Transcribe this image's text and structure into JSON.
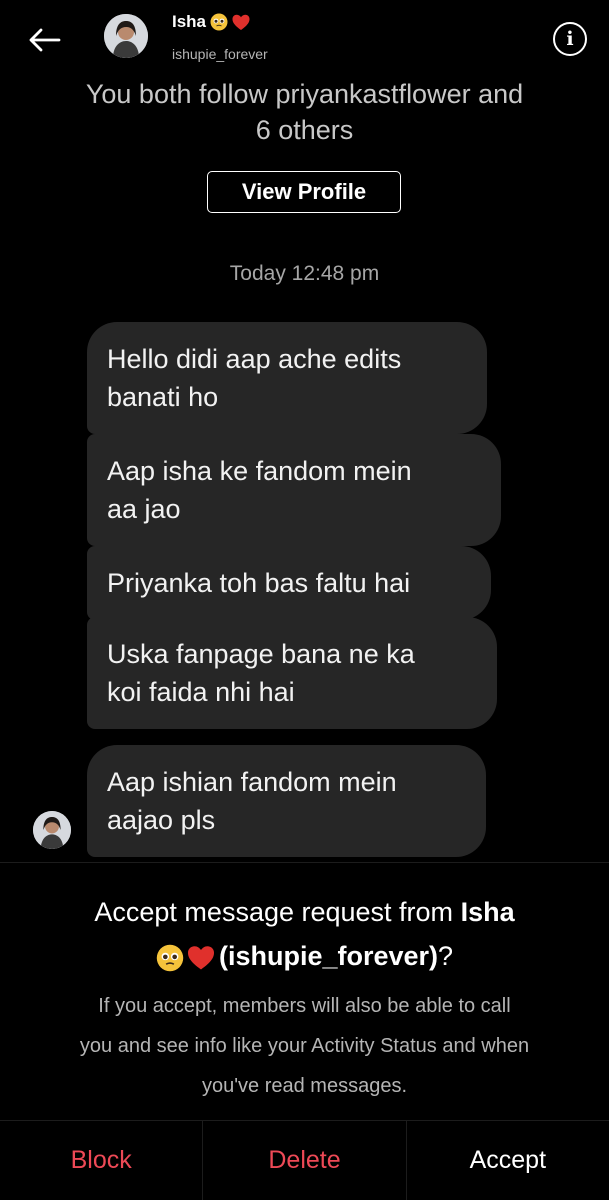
{
  "header": {
    "name": "Isha",
    "username": "ishupie_forever",
    "name_emojis": [
      "pleading-face-emoji",
      "red-heart-emoji"
    ]
  },
  "profile_card": {
    "mutual_line1": "You both follow priyankastflower and",
    "mutual_line2": "6 others",
    "view_profile_label": "View Profile"
  },
  "conversation": {
    "timestamp": "Today 12:48 pm",
    "messages": [
      {
        "line1": "Hello didi aap ache edits",
        "line2": "banati ho"
      },
      {
        "line1": "Aap isha ke fandom mein",
        "line2": "aa jao"
      },
      {
        "line1": "Priyanka toh bas faltu hai",
        "line2": ""
      },
      {
        "line1": "Uska fanpage bana ne ka",
        "line2": "koi faida nhi hai"
      },
      {
        "line1": "Aap ishian fandom mein",
        "line2": "aajao pls"
      }
    ]
  },
  "request": {
    "title_prefix": "Accept message request from ",
    "title_name": "Isha",
    "title_username": "(ishupie_forever)",
    "title_suffix": "?",
    "desc_line1": "If you accept, members will also be able to call",
    "desc_line2": "you and see info like your Activity Status and when",
    "desc_line3": "you've read messages."
  },
  "actions": {
    "block": "Block",
    "delete": "Delete",
    "accept": "Accept"
  },
  "colors": {
    "background": "#000000",
    "bubble": "#262626",
    "danger": "#ed4956",
    "muted_text": "#b5b5b5"
  }
}
